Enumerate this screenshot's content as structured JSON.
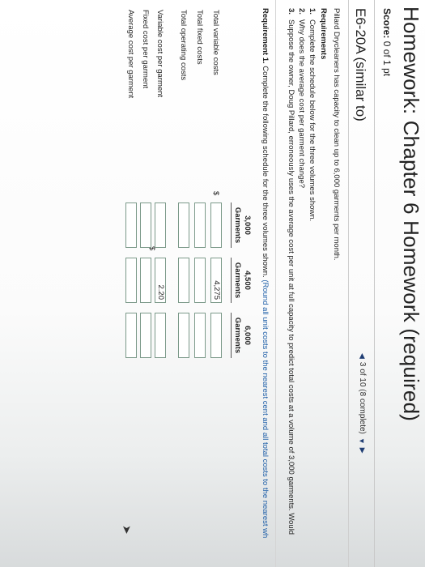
{
  "header": {
    "title": "Homework: Chapter 6 Homework (required)",
    "score_label": "Score:",
    "score_value": "0 of 1 pt"
  },
  "problem": {
    "id": "E6-20A (similar to)",
    "nav_text": "3 of 10 (8 complete)"
  },
  "question": {
    "intro": "Pillard Drycleaners has capacity to clean up to 6,000 garments per month.",
    "requirements_heading": "Requirements",
    "requirements": [
      {
        "num": "1.",
        "text": "Complete the schedule below for the three volumes shown."
      },
      {
        "num": "2.",
        "text": "Why does the average cost per garment change?"
      },
      {
        "num": "3.",
        "text": "Suppose the owner, Doug Pillard, erroneously uses the average cost per unit at full capacity to predict total costs at a volume of 3,000 garments. Would"
      }
    ],
    "instruction_bold": "Requirement 1.",
    "instruction_text": " Complete the following schedule for the three volumes shown. ",
    "instruction_note": "(Round all unit costs to the nearest cent and all total costs to the nearest wh"
  },
  "schedule": {
    "columns": [
      {
        "amount": "3,000",
        "label": "Garments"
      },
      {
        "amount": "4,500",
        "label": "Garments"
      },
      {
        "amount": "6,000",
        "label": "Garments"
      }
    ],
    "currency_symbol": "$",
    "rows": {
      "total_variable_costs": {
        "label": "Total variable costs",
        "values": [
          "",
          "4,275",
          ""
        ]
      },
      "total_fixed_costs": {
        "label": "Total fixed costs",
        "values": [
          "",
          "",
          ""
        ]
      },
      "total_operating_costs": {
        "label": "Total operating costs",
        "values": [
          "",
          "",
          ""
        ]
      },
      "variable_cost_per_garment": {
        "label": "Variable cost per garment",
        "values": [
          "",
          "2.20",
          ""
        ]
      },
      "fixed_cost_per_garment": {
        "label": "Fixed cost per garment",
        "values": [
          "",
          "",
          ""
        ]
      },
      "average_cost_per_garment": {
        "label": "Average cost per garment",
        "values": [
          "",
          "",
          ""
        ]
      }
    }
  }
}
